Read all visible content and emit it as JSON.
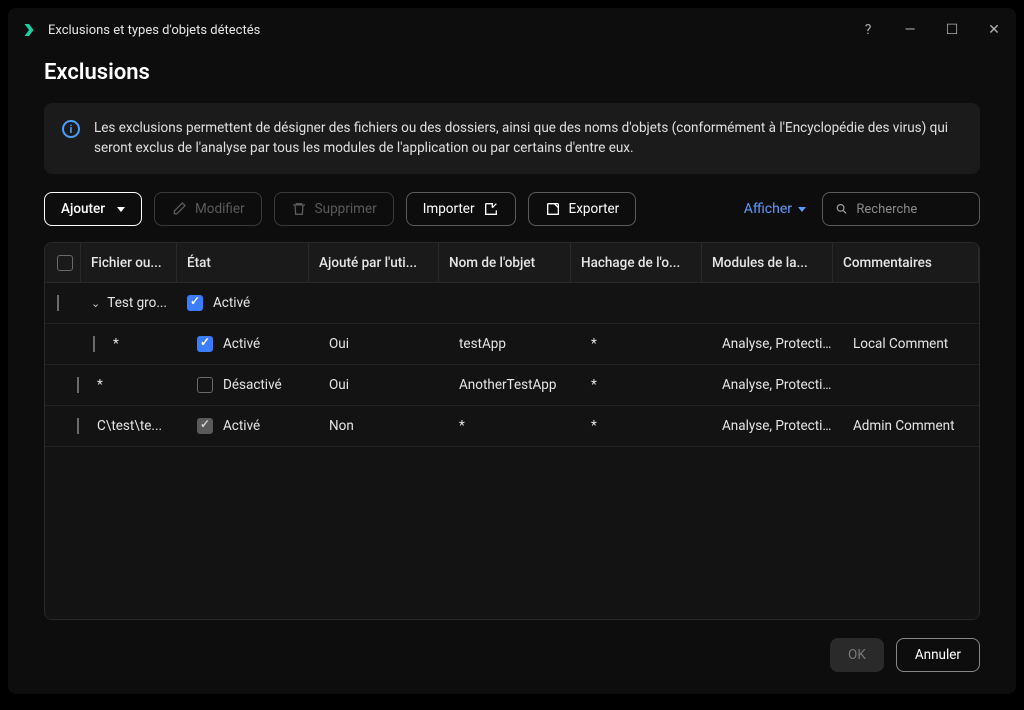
{
  "window": {
    "title": "Exclusions et types d'objets détectés"
  },
  "page": {
    "heading": "Exclusions",
    "info": "Les exclusions permettent de désigner des fichiers ou des dossiers, ainsi que des noms d'objets (conformément à l'Encyclopédie des virus) qui seront exclus de l'analyse par tous les modules de l'application ou par certains d'entre eux."
  },
  "toolbar": {
    "add": "Ajouter",
    "edit": "Modifier",
    "delete": "Supprimer",
    "import": "Importer",
    "export": "Exporter",
    "show": "Afficher",
    "search_placeholder": "Recherche"
  },
  "columns": {
    "file": "Fichier ou...",
    "state": "État",
    "added": "Ajouté par l'uti...",
    "object": "Nom de l'objet",
    "hash": "Hachage de l'o...",
    "modules": "Modules de la...",
    "comments": "Commentaires"
  },
  "rows": [
    {
      "type": "group",
      "file": "Test gro...",
      "state_on": true,
      "state_gray": false,
      "state": "Activé",
      "added": "",
      "object": "",
      "hash": "",
      "modules": "",
      "comments": ""
    },
    {
      "type": "child",
      "indent": 1,
      "file": "*",
      "state_on": true,
      "state_gray": false,
      "state": "Activé",
      "added": "Oui",
      "object": "testApp",
      "hash": "*",
      "modules": "Analyse, Protecti...",
      "comments": "Local Comment"
    },
    {
      "type": "child",
      "indent": 2,
      "file": "*",
      "state_on": false,
      "state_gray": false,
      "state": "Désactivé",
      "added": "Oui",
      "object": "AnotherTestApp",
      "hash": "*",
      "modules": "Analyse, Protecti...",
      "comments": ""
    },
    {
      "type": "child",
      "indent": 2,
      "file": "C\\test\\te...",
      "state_on": true,
      "state_gray": true,
      "state": "Activé",
      "added": "Non",
      "object": "*",
      "hash": "*",
      "modules": "Analyse, Protecti...",
      "comments": "Admin Comment"
    }
  ],
  "footer": {
    "ok": "OK",
    "cancel": "Annuler"
  }
}
